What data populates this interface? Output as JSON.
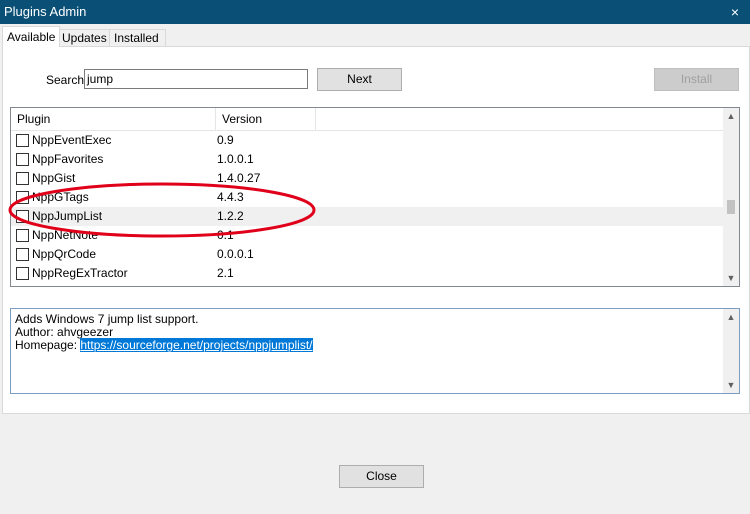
{
  "window": {
    "title": "Plugins Admin",
    "close_glyph": "×"
  },
  "tabs": [
    {
      "label": "Available",
      "active": true
    },
    {
      "label": "Updates",
      "active": false
    },
    {
      "label": "Installed",
      "active": false
    }
  ],
  "search": {
    "label": "Search:",
    "value": "jump"
  },
  "buttons": {
    "next": "Next",
    "install": "Install",
    "close": "Close"
  },
  "list": {
    "columns": {
      "plugin": "Plugin",
      "version": "Version"
    },
    "rows": [
      {
        "name": "NppEventExec",
        "version": "0.9",
        "checked": false
      },
      {
        "name": "NppFavorites",
        "version": "1.0.0.1",
        "checked": false
      },
      {
        "name": "NppGist",
        "version": "1.4.0.27",
        "checked": false
      },
      {
        "name": "NppGTags",
        "version": "4.4.3",
        "checked": false
      },
      {
        "name": "NppJumpList",
        "version": "1.2.2",
        "checked": false,
        "selected": true
      },
      {
        "name": "NppNetNote",
        "version": "0.1",
        "checked": false
      },
      {
        "name": "NppQrCode",
        "version": "0.0.0.1",
        "checked": false
      },
      {
        "name": "NppRegExTractor",
        "version": "2.1",
        "checked": false
      }
    ]
  },
  "description": {
    "line1": "Adds Windows 7 jump list support.",
    "line2": "Author: ahvgeezer",
    "homepage_label": "Homepage: ",
    "homepage_url": "https://sourceforge.net/projects/nppjumplist/"
  },
  "colors": {
    "titlebar": "#0a5076",
    "annotation": "#e0001a",
    "link_highlight": "#0078d7"
  },
  "annotation": "red-ellipse-highlight"
}
